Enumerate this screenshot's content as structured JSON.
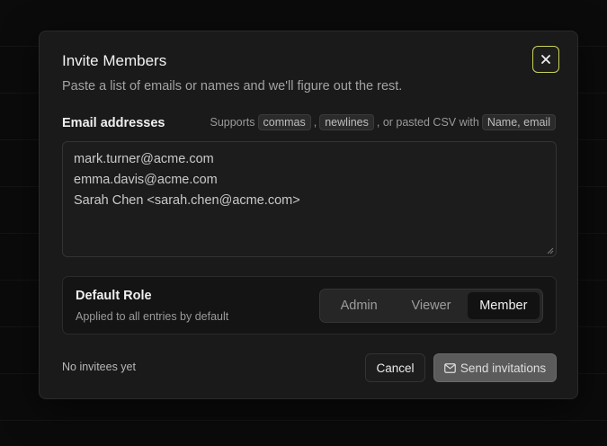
{
  "modal": {
    "title": "Invite Members",
    "description": "Paste a list of emails or names and we'll figure out the rest.",
    "close_icon": "close-icon"
  },
  "emails": {
    "label": "Email addresses",
    "hint_prefix": "Supports",
    "hint_commas": "commas",
    "hint_sep": ",",
    "hint_newlines": "newlines",
    "hint_middle": ", or pasted CSV with",
    "hint_csv": "Name, email",
    "lines": [
      "mark.turner@acme.com",
      "emma.davis@acme.com",
      "Sarah Chen <sarah.chen@acme.com>"
    ]
  },
  "role": {
    "title": "Default Role",
    "subtitle": "Applied to all entries by default",
    "options": [
      "Admin",
      "Viewer",
      "Member"
    ],
    "selected": "Member"
  },
  "footer": {
    "status": "No invitees yet",
    "cancel_label": "Cancel",
    "send_label": "Send invitations",
    "send_icon": "mail-icon"
  },
  "colors": {
    "focus_ring": "#c9d25a",
    "modal_bg": "#1a1a1a",
    "send_button_bg": "#5b5b5b"
  }
}
